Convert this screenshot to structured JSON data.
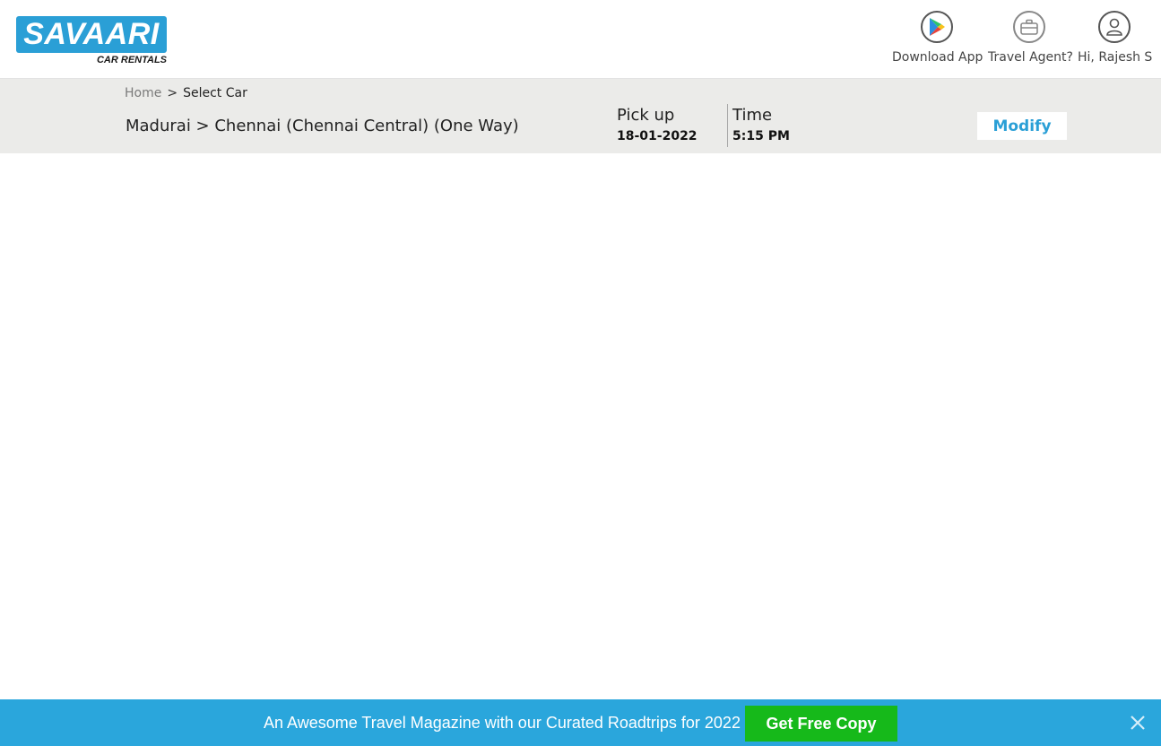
{
  "header": {
    "logo": {
      "main": "SAVAARI",
      "sub": "CAR RENTALS"
    },
    "items": [
      {
        "label": "Download App",
        "icon": "play-store-icon"
      },
      {
        "label": "Travel Agent?",
        "icon": "briefcase-icon"
      },
      {
        "label": "Hi, Rajesh S",
        "icon": "user-icon"
      }
    ]
  },
  "breadcrumb": {
    "home": "Home",
    "separator": ">",
    "current": "Select Car"
  },
  "trip": {
    "route": "Madurai > Chennai (Chennai Central) (One Way)",
    "pickup_label": "Pick up",
    "pickup_date": "18-01-2022",
    "time_label": "Time",
    "time_value": "5:15 PM",
    "modify_label": "Modify"
  },
  "banner": {
    "text": "An Awesome Travel Magazine with our Curated Roadtrips for 2022",
    "button_label": "Get Free Copy",
    "close_icon": "close-icon"
  },
  "colors": {
    "brand_blue": "#2a9fd6",
    "banner_blue": "#2aa6dc",
    "cta_green": "#16b91a",
    "subbar_gray": "#ebebe9"
  }
}
